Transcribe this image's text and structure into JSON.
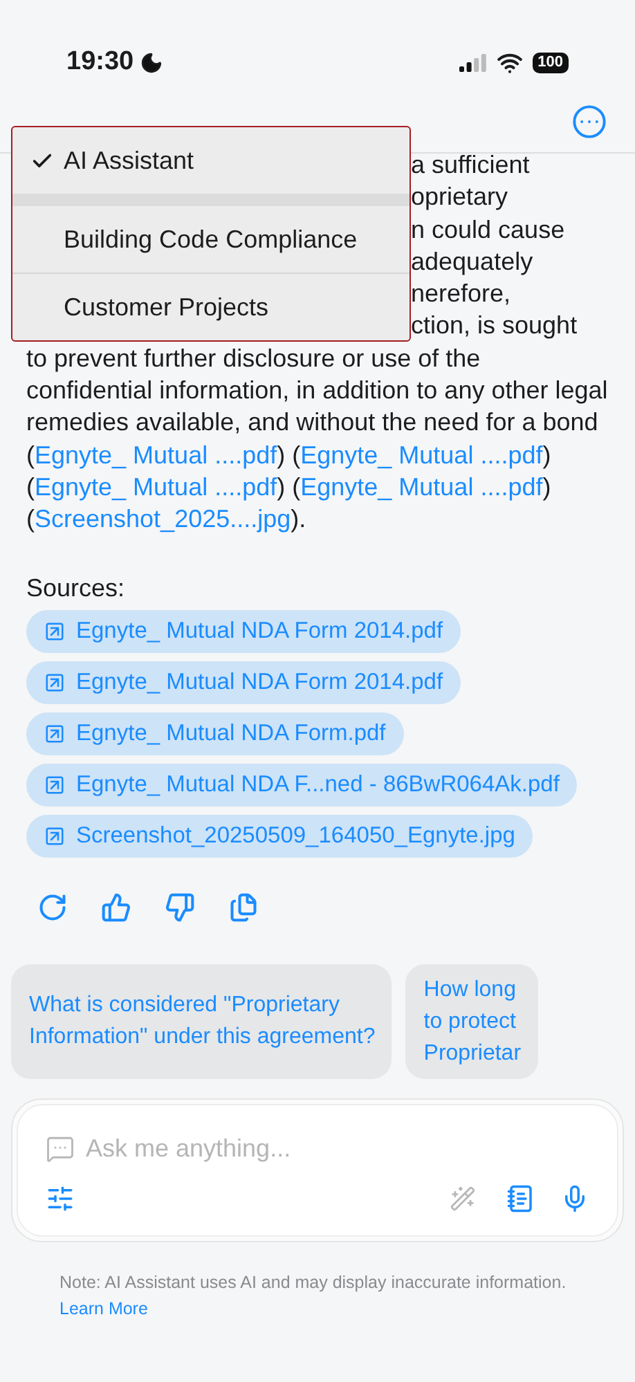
{
  "status_bar": {
    "time": "19:30",
    "battery": "100"
  },
  "answer": {
    "covered_line_ends": [
      "a sufficient",
      "oprietary",
      "n could cause",
      "adequately",
      "nerefore,",
      "ction, is sought"
    ],
    "segments": [
      {
        "kind": "text",
        "text": "to prevent further disclosure or use of the confidential information, in addition to any other legal remedies available, and without the need for a bond ("
      },
      {
        "kind": "link",
        "text": "Egnyte_ Mutual ....pdf"
      },
      {
        "kind": "text",
        "text": ") ("
      },
      {
        "kind": "link",
        "text": "Egnyte_ Mutual ....pdf"
      },
      {
        "kind": "text",
        "text": ") ("
      },
      {
        "kind": "link",
        "text": "Egnyte_ Mutual ....pdf"
      },
      {
        "kind": "text",
        "text": ") ("
      },
      {
        "kind": "link",
        "text": "Egnyte_ Mutual ....pdf"
      },
      {
        "kind": "text",
        "text": ") ("
      },
      {
        "kind": "link",
        "text": "Screenshot_2025....jpg"
      },
      {
        "kind": "text",
        "text": ")."
      }
    ]
  },
  "sources": {
    "label": "Sources:",
    "items": [
      "Egnyte_ Mutual NDA Form 2014.pdf",
      "Egnyte_ Mutual NDA Form 2014.pdf",
      "Egnyte_ Mutual NDA Form.pdf",
      "Egnyte_ Mutual NDA F...ned - 86BwR064Ak.pdf",
      "Screenshot_20250509_164050_Egnyte.jpg"
    ]
  },
  "suggestions": [
    {
      "lines": [
        "What is considered \"Proprietary",
        "Information\" under this agreement?"
      ]
    },
    {
      "lines": [
        "How long",
        "to protect",
        "Proprietar"
      ]
    }
  ],
  "composer": {
    "placeholder": "Ask me anything..."
  },
  "note": {
    "text": "Note: AI Assistant uses AI and may display inaccurate information.",
    "link": "Learn More"
  },
  "assistant_menu": {
    "items": [
      {
        "label": "AI Assistant",
        "selected": true
      },
      {
        "label": "Building Code Compliance",
        "selected": false
      },
      {
        "label": "Customer Projects",
        "selected": false
      }
    ]
  }
}
